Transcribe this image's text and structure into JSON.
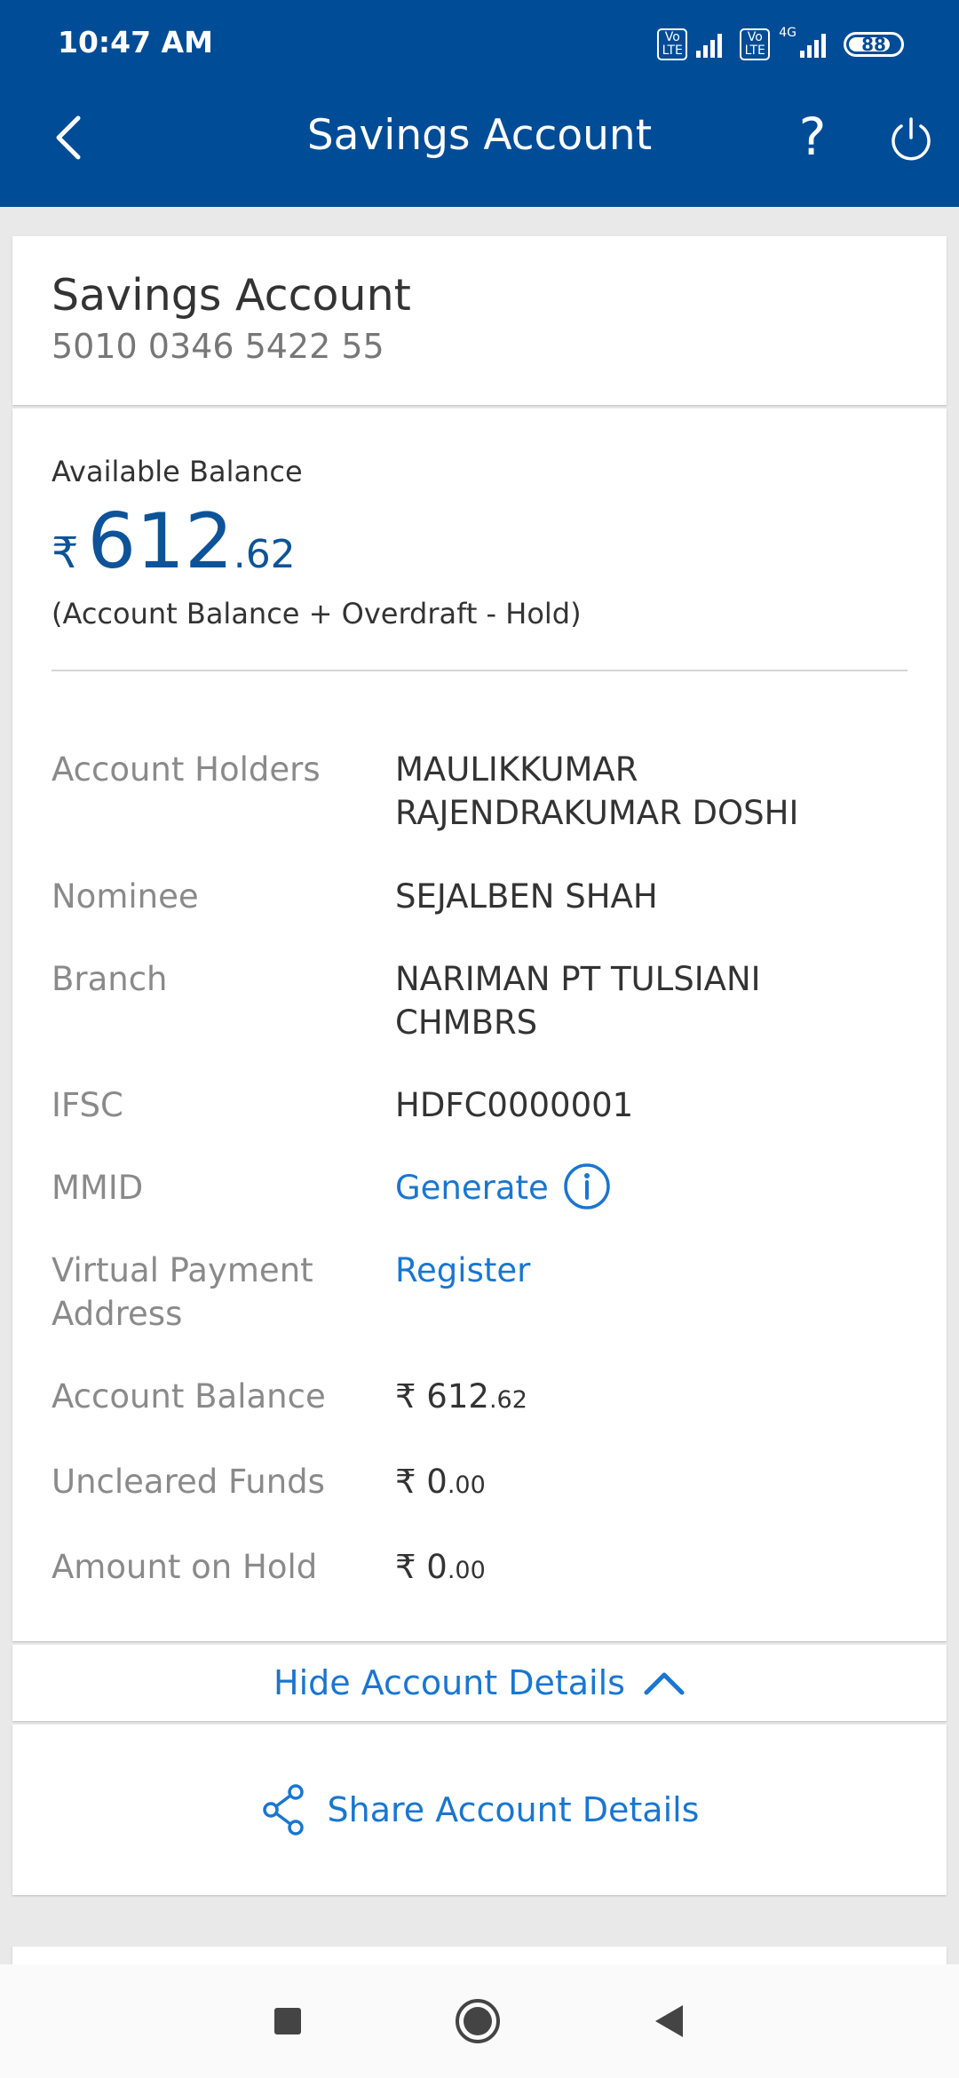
{
  "status_bar": {
    "time": "10:47 AM",
    "volte1": "Vo LTE",
    "volte2": "Vo LTE",
    "network": "4G",
    "battery": "88"
  },
  "app_bar": {
    "title": "Savings Account",
    "back_icon": "chevron-left-icon",
    "help_label": "?",
    "power_icon": "power-icon",
    "color": "#004c97"
  },
  "account": {
    "name": "Savings Account",
    "number": "5010 0346 5422 55"
  },
  "balance": {
    "label": "Available Balance",
    "currency": "₹",
    "whole": "612",
    "fraction": ".62",
    "note": "(Account Balance + Overdraft - Hold)"
  },
  "details": {
    "account_holders_label": "Account Holders",
    "account_holders_value": "MAULIKKUMAR RAJENDRAKUMAR DOSHI",
    "nominee_label": "Nominee",
    "nominee_value": "SEJALBEN SHAH",
    "branch_label": "Branch",
    "branch_value": "NARIMAN PT TULSIANI CHMBRS",
    "ifsc_label": "IFSC",
    "ifsc_value": "HDFC0000001",
    "mmid_label": "MMID",
    "mmid_action": "Generate",
    "vpa_label": "Virtual Payment Address",
    "vpa_action": "Register",
    "account_balance_label": "Account Balance",
    "account_balance_whole": "₹ 612",
    "account_balance_fraction": ".62",
    "uncleared_label": "Uncleared Funds",
    "uncleared_whole": "₹ 0",
    "uncleared_fraction": ".00",
    "hold_label": "Amount on Hold",
    "hold_whole": "₹ 0",
    "hold_fraction": ".00"
  },
  "actions": {
    "hide_details": "Hide Account Details",
    "share_details": "Share Account Details",
    "link_color": "#1976d2"
  },
  "nav": {
    "recents_icon": "square-icon",
    "home_icon": "circle-icon",
    "back_icon": "triangle-back-icon"
  }
}
